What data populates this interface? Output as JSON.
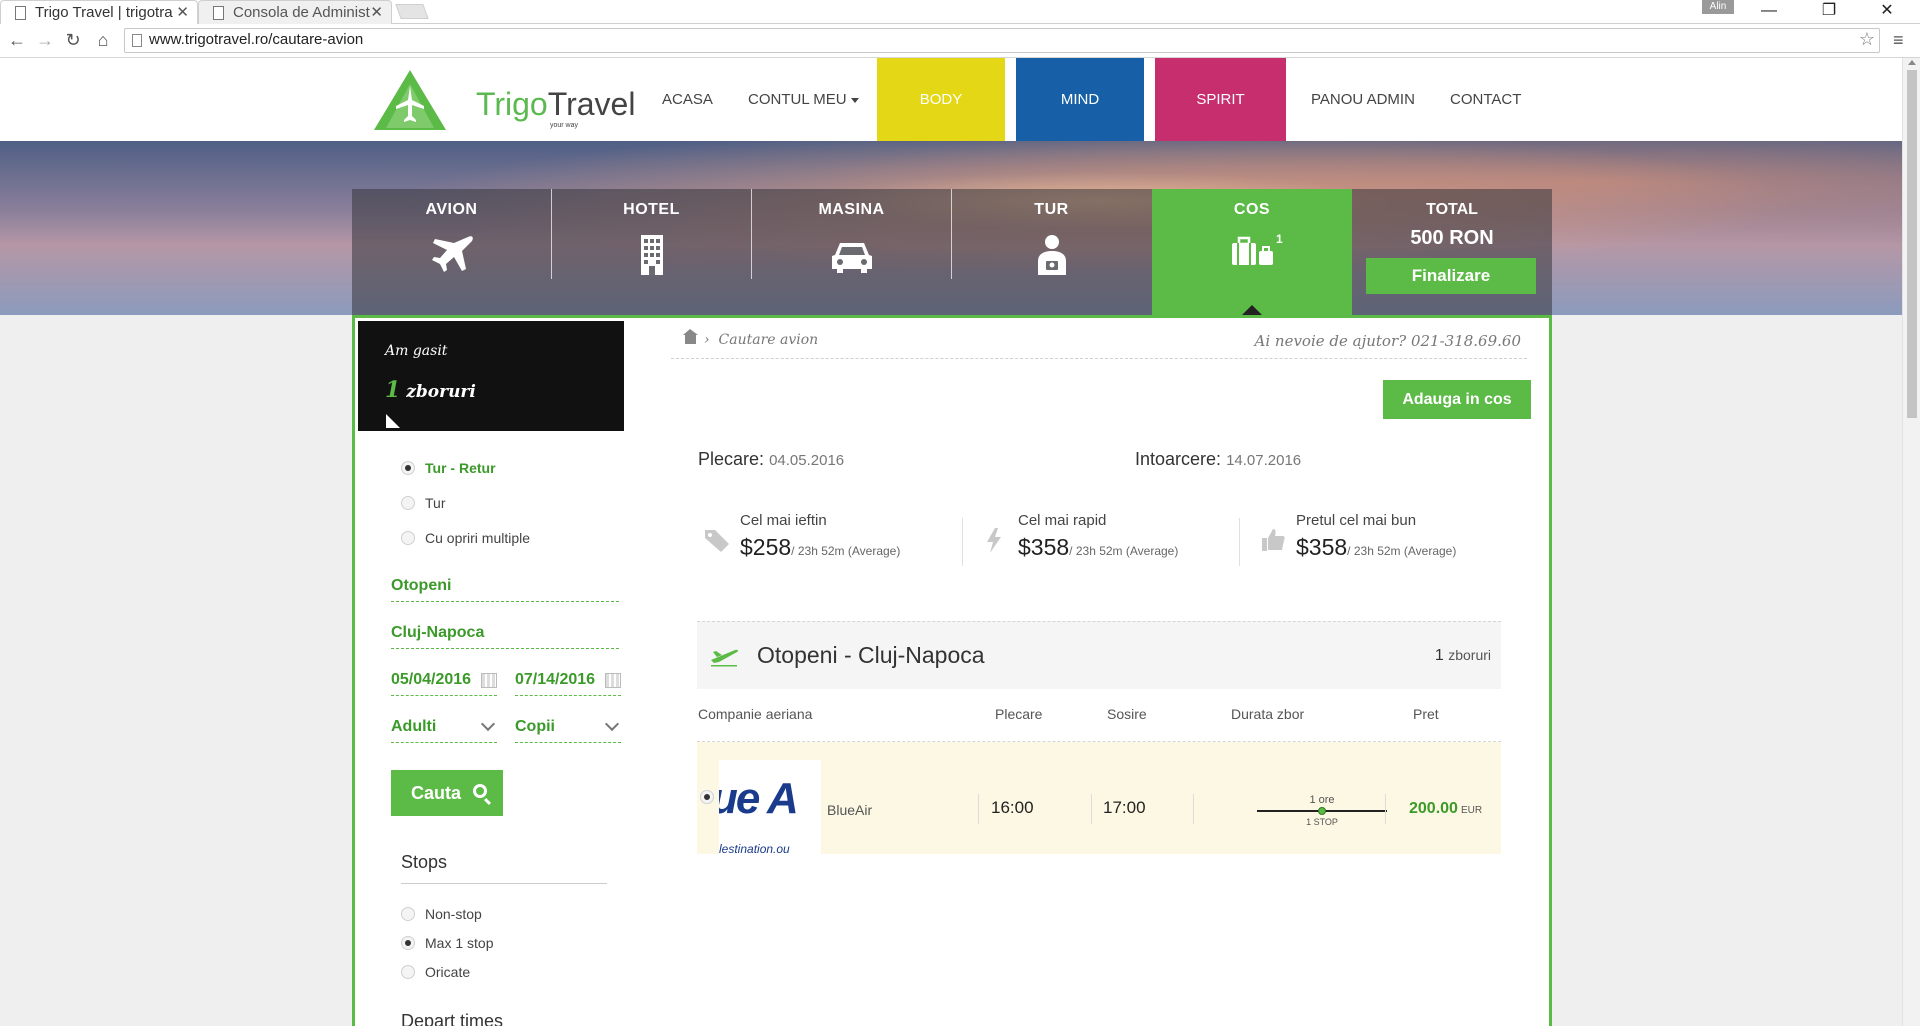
{
  "browser": {
    "tabs": [
      {
        "title": "Trigo Travel | trigotra",
        "active": true
      },
      {
        "title": "Consola de Administ",
        "active": false
      }
    ],
    "user_badge": "Alin",
    "url": "www.trigotravel.ro/cautare-avion",
    "window_controls": {
      "minimize": "—",
      "restore": "❐",
      "close": "✕"
    },
    "nav": {
      "back": "←",
      "forward": "→",
      "reload": "↻",
      "home": "⌂"
    },
    "tab_close": "✕",
    "star": "☆",
    "menu": "≡"
  },
  "header": {
    "logo": {
      "word1": "Trigo",
      "word2": "Travel",
      "tagline": "your way"
    },
    "nav": {
      "home": "ACASA",
      "account": "CONTUL MEU",
      "body": "BODY",
      "mind": "MIND",
      "spirit": "SPIRIT",
      "admin": "PANOU ADMIN",
      "contact": "CONTACT"
    },
    "colors": {
      "body": "#e4d816",
      "mind": "#1760a8",
      "spirit": "#c62e6e"
    }
  },
  "search_tabs": [
    {
      "label": "AVION",
      "icon": "plane-icon"
    },
    {
      "label": "HOTEL",
      "icon": "building-icon"
    },
    {
      "label": "MASINA",
      "icon": "car-icon"
    },
    {
      "label": "TUR",
      "icon": "guide-icon"
    },
    {
      "label": "COS",
      "icon": "luggage-icon",
      "active": true,
      "count": "1"
    }
  ],
  "total": {
    "label": "TOTAL",
    "value": "500 RON",
    "button": "Finalizare"
  },
  "sidebar": {
    "found_label": "Am gasit",
    "found_number": "1",
    "found_unit": "zboruri",
    "trip_types": [
      {
        "label": "Tur - Retur",
        "selected": true
      },
      {
        "label": "Tur",
        "selected": false
      },
      {
        "label": "Cu opriri multiple",
        "selected": false
      }
    ],
    "from": "Otopeni",
    "to": "Cluj-Napoca",
    "depart_date": "05/04/2016",
    "return_date": "07/14/2016",
    "adults": "Adulti",
    "children": "Copii",
    "search_button": "Cauta",
    "stops_title": "Stops",
    "stops": [
      {
        "label": "Non-stop",
        "selected": false
      },
      {
        "label": "Max 1 stop",
        "selected": true
      },
      {
        "label": "Oricate",
        "selected": false
      }
    ],
    "depart_times_title": "Depart times"
  },
  "content": {
    "breadcrumb": "Cautare avion",
    "breadcrumb_sep": "›",
    "help_prefix": "Ai nevoie de ajutor?",
    "help_phone": "021-318.69.60",
    "add_to_cart": "Adauga in cos",
    "departure_label": "Plecare:",
    "departure_value": "04.05.2016",
    "return_label": "Intoarcere:",
    "return_value": "14.07.2016",
    "summaries": [
      {
        "label": "Cel mai ieftin",
        "price": "$258",
        "duration": "/ 23h 52m (Average)",
        "icon": "tag-icon"
      },
      {
        "label": "Cel mai rapid",
        "price": "$358",
        "duration": "/ 23h 52m (Average)",
        "icon": "bolt-icon"
      },
      {
        "label": "Pretul cel mai bun",
        "price": "$358",
        "duration": "/ 23h 52m (Average)",
        "icon": "thumbs-up-icon"
      }
    ],
    "route": {
      "title": "Otopeni - Cluj-Napoca",
      "count": "1",
      "count_unit": "zboruri"
    },
    "columns": {
      "airline": "Companie aeriana",
      "depart": "Plecare",
      "arrive": "Sosire",
      "duration": "Durata zbor",
      "price": "Pret"
    },
    "flights": [
      {
        "logo_text": "ue A",
        "logo_sub": "lestination.ou",
        "airline": "BlueAir",
        "depart": "16:00",
        "arrive": "17:00",
        "duration": "1 ore",
        "stops": "1 STOP",
        "price": "200.00",
        "currency": "EUR"
      }
    ]
  }
}
